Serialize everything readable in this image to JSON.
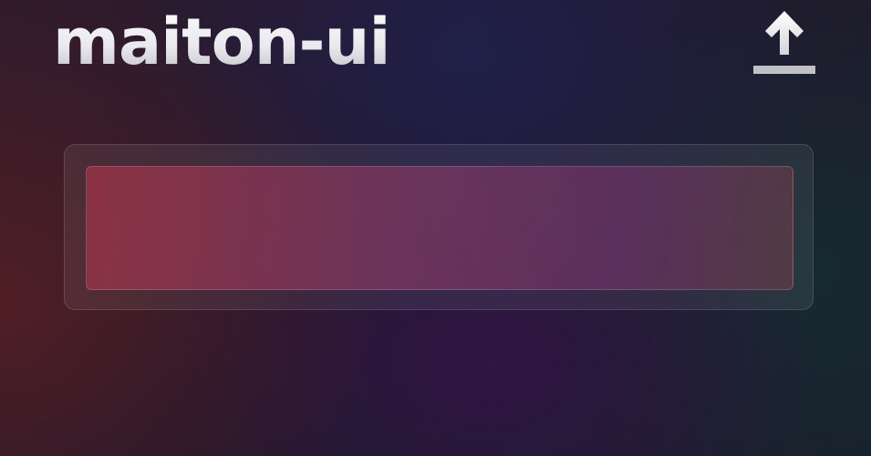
{
  "app": {
    "title": "maiton-ui"
  },
  "header": {
    "upload_icon": "upload-icon"
  },
  "main": {
    "input": {
      "value": "",
      "placeholder": ""
    }
  },
  "colors": {
    "title_fill": "#f2f2f5",
    "icon_fill": "#eeeeee",
    "icon_underline": "#c0c0c6",
    "input_tint": "#8e3448"
  }
}
